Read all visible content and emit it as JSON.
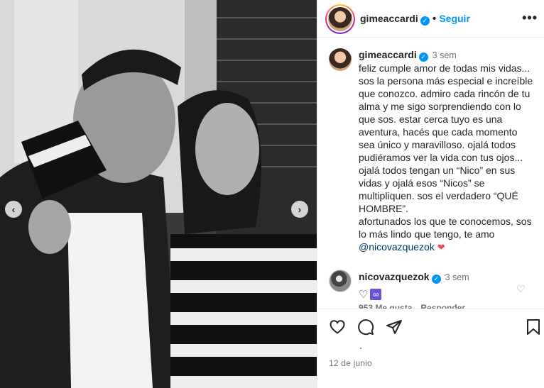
{
  "header": {
    "username": "gimeaccardi",
    "follow_label": "Seguir",
    "more_label": "•••"
  },
  "caption": {
    "username": "gimeaccardi",
    "time": "3 sem",
    "text": "feliz cumple amor de todas mis vidas... sos la persona más especial e increíble que conozco. admiro cada rincón de tu alma y me sigo sorprendiendo con lo que sos. estar cerca tuyo es una aventura, hacés que cada momento sea único y maravilloso. ojalá todos pudiéramos ver la vida con tus ojos... ojalá todos tengan un “Nico” en sus vidas y ojalá esos “Nicos” se multipliquen. sos el verdadero “QUÉ HOMBRE”.\nafortunados los que te conocemos, sos lo más lindo que tengo, te amo",
    "mention": "@nicovazquezok"
  },
  "comment": {
    "username": "nicovazquezok",
    "time": "3 sem",
    "likes": "953 Me gusta",
    "reply_label": "Responder"
  },
  "footer": {
    "date": "12 de junio"
  },
  "icons": {
    "prev": "chevron-left-icon",
    "next": "chevron-right-icon",
    "like": "heart-icon",
    "comment": "comment-icon",
    "share": "share-icon",
    "save": "bookmark-icon"
  },
  "colors": {
    "accent": "#0095f6",
    "mention": "#00376b",
    "secondary_text": "#737373"
  }
}
